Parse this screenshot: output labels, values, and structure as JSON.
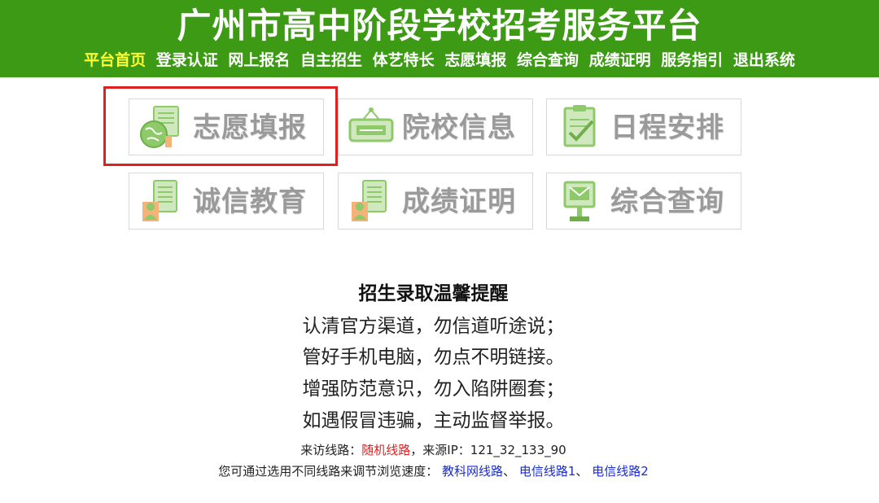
{
  "header": {
    "title": "广州市高中阶段学校招考服务平台",
    "nav": [
      {
        "label": "平台首页",
        "active": true
      },
      {
        "label": "登录认证"
      },
      {
        "label": "网上报名"
      },
      {
        "label": "自主招生"
      },
      {
        "label": "体艺特长"
      },
      {
        "label": "志愿填报"
      },
      {
        "label": "综合查询"
      },
      {
        "label": "成绩证明"
      },
      {
        "label": "服务指引"
      },
      {
        "label": "退出系统"
      }
    ]
  },
  "tiles": [
    {
      "label": "志愿填报",
      "icon": "globe-document-icon",
      "highlighted": true
    },
    {
      "label": "院校信息",
      "icon": "signboard-icon"
    },
    {
      "label": "日程安排",
      "icon": "checklist-icon"
    },
    {
      "label": "诚信教育",
      "icon": "person-document-icon"
    },
    {
      "label": "成绩证明",
      "icon": "person-document-icon"
    },
    {
      "label": "综合查询",
      "icon": "mail-stand-icon"
    }
  ],
  "notice": {
    "title": "招生录取温馨提醒",
    "lines": [
      "认清官方渠道，勿信道听途说；",
      "管好手机电脑，勿点不明链接。",
      "增强防范意识，勿入陷阱圈套；",
      "如遇假冒违骗，主动监督举报。"
    ]
  },
  "route": {
    "prefix": "来访线路：",
    "current": "随机线路",
    "ip_label": "，来源IP：",
    "ip": "121_32_133_90",
    "choice_text": "您可通过选用不同线路来调节浏览速度：",
    "links": [
      "教科网线路",
      "电信线路1",
      "电信线路2"
    ],
    "sep": "、"
  },
  "colors": {
    "header_bg": "#3c9a14",
    "nav_active": "#ffff33",
    "highlight": "#e02020",
    "icon_green": "#8ec96a",
    "link": "#1a2dcc"
  }
}
